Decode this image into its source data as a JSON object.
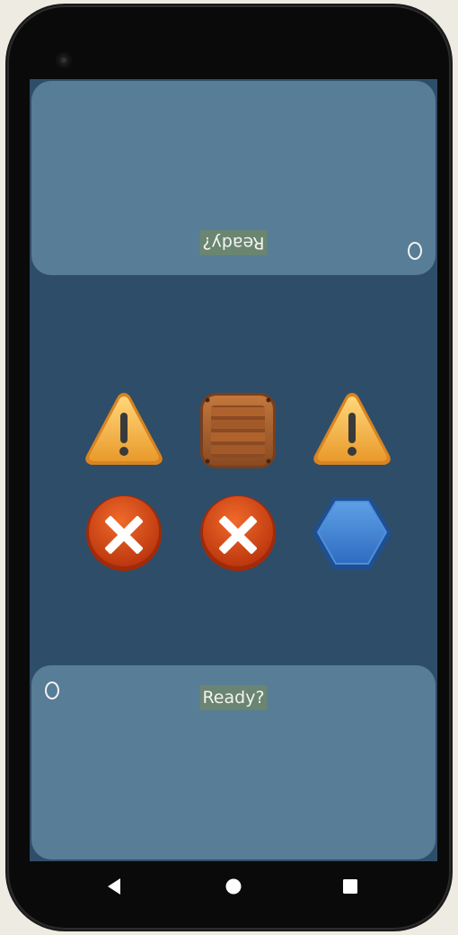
{
  "top_panel": {
    "label": "Ready?"
  },
  "bottom_panel": {
    "label": "Ready?"
  },
  "board": {
    "rows": [
      [
        "warning-icon",
        "crate-icon",
        "warning-icon"
      ],
      [
        "x-circle-icon",
        "x-circle-icon",
        "hexagon-icon"
      ]
    ]
  },
  "colors": {
    "board_background": "#2e4d69",
    "panel_background": "#587d96",
    "label_background": "#6a8571"
  },
  "navigation": {
    "buttons": [
      "back-icon",
      "home-icon",
      "recents-icon"
    ]
  }
}
